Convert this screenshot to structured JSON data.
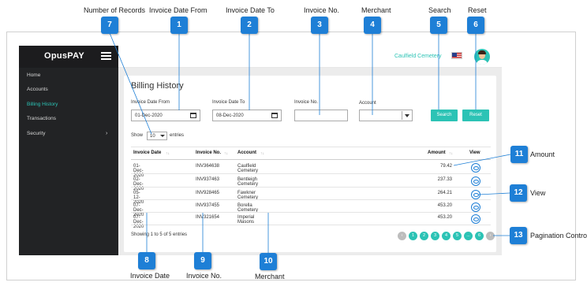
{
  "app": {
    "brand": "OpusPAY",
    "company": "Caulfield Cemetery"
  },
  "sidebar": {
    "items": [
      {
        "label": "Home",
        "active": false
      },
      {
        "label": "Accounts",
        "active": false
      },
      {
        "label": "Billing History",
        "active": true
      },
      {
        "label": "Transactions",
        "active": false
      },
      {
        "label": "Security",
        "active": false
      }
    ],
    "chevron": "›"
  },
  "page": {
    "title": "Billing History"
  },
  "filters": {
    "date_from": {
      "label": "Invoice Date From",
      "value": "01-Dec-2020"
    },
    "date_to": {
      "label": "Invoice Date To",
      "value": "08-Dec-2020"
    },
    "invoice_no": {
      "label": "Invoice No.",
      "value": ""
    },
    "account": {
      "label": "Account",
      "value": ""
    },
    "search_label": "Search",
    "reset_label": "Reset"
  },
  "length": {
    "show": "Show",
    "value": "10",
    "entries": "entries"
  },
  "table": {
    "columns": [
      "Invoice Date",
      "Invoice No.",
      "Account",
      "Amount",
      "View"
    ],
    "sort_glyph": "↑↓",
    "rows": [
      [
        "01-Dec-2020",
        "INV364638",
        "Caulfield Cemetery",
        "79.42"
      ],
      [
        "02-Dec-2020",
        "INV937463",
        "Bentleigh Cemetery",
        "237.33"
      ],
      [
        "05-12-2020",
        "INV928465",
        "Fawkner Cemetery",
        "264.21"
      ],
      [
        "07-Dec-2020",
        "INV937455",
        "Borella Cemetery",
        "453.20"
      ],
      [
        "07-Dec-2020",
        "INV321654",
        "Imperial Masons",
        "453.20"
      ]
    ]
  },
  "info": "Showing 1 to 5 of 5 entries",
  "pagination": [
    "‹",
    "1",
    "2",
    "3",
    "4",
    "5",
    "...",
    "6",
    "›"
  ],
  "callouts": {
    "m1": {
      "n": "1",
      "label": "Invoice Date From"
    },
    "m2": {
      "n": "2",
      "label": "Invoice Date To"
    },
    "m3": {
      "n": "3",
      "label": "Invoice No."
    },
    "m4": {
      "n": "4",
      "label": "Merchant"
    },
    "m5": {
      "n": "5",
      "label": "Search"
    },
    "m6": {
      "n": "6",
      "label": "Reset"
    },
    "m7": {
      "n": "7",
      "label": "Number of Records"
    },
    "m8": {
      "n": "8",
      "label": "Invoice Date"
    },
    "m9": {
      "n": "9",
      "label": "Invoice No."
    },
    "m10": {
      "n": "10",
      "label": "Merchant"
    },
    "m11": {
      "n": "11",
      "label": "Amount"
    },
    "m12": {
      "n": "12",
      "label": "View"
    },
    "m13": {
      "n": "13",
      "label": "Pagination Control"
    }
  },
  "colors": {
    "accent": "#2cc3b5",
    "marker": "#1e7fd6",
    "sidebar": "#222325"
  }
}
